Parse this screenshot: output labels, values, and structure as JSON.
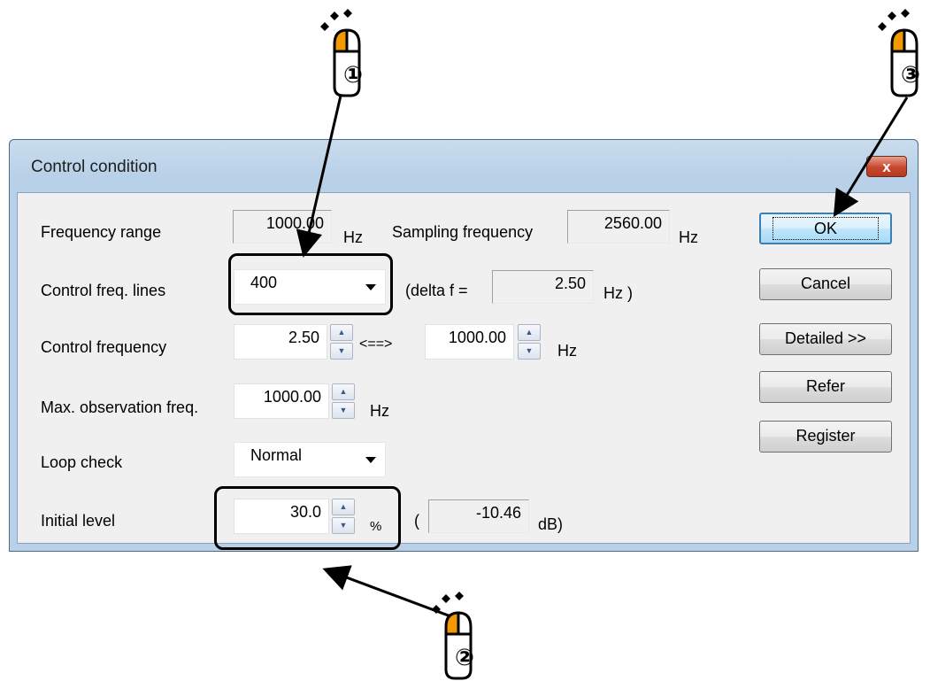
{
  "dialog": {
    "title": "Control condition",
    "close_glyph": "x"
  },
  "fields": {
    "frequency_range": {
      "label": "Frequency range",
      "value": "1000.00",
      "unit": "Hz"
    },
    "sampling_frequency": {
      "label": "Sampling frequency",
      "value": "2560.00",
      "unit": "Hz"
    },
    "control_freq_lines": {
      "label": "Control freq. lines",
      "value": "400"
    },
    "delta_f": {
      "prefix": "(delta f =",
      "value": "2.50",
      "unit": "Hz )"
    },
    "control_frequency": {
      "label": "Control frequency",
      "low": "2.50",
      "sep": "<==>",
      "high": "1000.00",
      "unit": "Hz"
    },
    "max_observation_freq": {
      "label": "Max. observation freq.",
      "value": "1000.00",
      "unit": "Hz"
    },
    "loop_check": {
      "label": "Loop check",
      "value": "Normal"
    },
    "initial_level": {
      "label": "Initial level",
      "value": "30.0",
      "unit": "%",
      "open_paren": "(",
      "db_value": "-10.46",
      "db_unit": "dB)"
    }
  },
  "buttons": {
    "ok": "OK",
    "cancel": "Cancel",
    "detailed": "Detailed >>",
    "refer": "Refer",
    "register": "Register"
  },
  "callouts": [
    "①",
    "②",
    "③"
  ],
  "colors": {
    "mouse_accent": "#f39800",
    "title_bar": "#b9d1e8",
    "close": "#c7462e"
  }
}
